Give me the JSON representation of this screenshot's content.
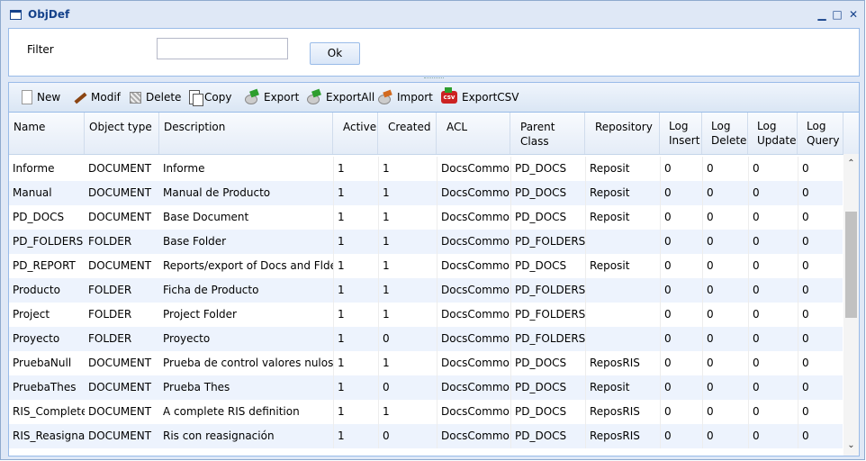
{
  "window": {
    "title": "ObjDef"
  },
  "filter": {
    "label": "Filter",
    "value": "",
    "ok_label": "Ok"
  },
  "toolbar": {
    "new_label": "New",
    "modif_label": "Modif",
    "delete_label": "Delete",
    "copy_label": "Copy",
    "export_label": "Export",
    "exportall_label": "ExportAll",
    "import_label": "Import",
    "exportcsv_label": "ExportCSV"
  },
  "columns": [
    {
      "label": "Name"
    },
    {
      "label": "Object type"
    },
    {
      "label": "Description"
    },
    {
      "label": "Active"
    },
    {
      "label": "Created"
    },
    {
      "label": "ACL"
    },
    {
      "label": "Parent Class"
    },
    {
      "label": "Repository"
    },
    {
      "label": "Log Insert"
    },
    {
      "label": "Log Delete"
    },
    {
      "label": "Log Update"
    },
    {
      "label": "Log Query"
    }
  ],
  "rows": [
    [
      "Informe",
      "DOCUMENT",
      "Informe",
      "1",
      "1",
      "DocsCommon",
      "PD_DOCS",
      "Reposit",
      "0",
      "0",
      "0",
      "0"
    ],
    [
      "Manual",
      "DOCUMENT",
      "Manual de Producto",
      "1",
      "1",
      "DocsCommon",
      "PD_DOCS",
      "Reposit",
      "0",
      "0",
      "0",
      "0"
    ],
    [
      "PD_DOCS",
      "DOCUMENT",
      "Base Document",
      "1",
      "1",
      "DocsCommon",
      "PD_DOCS",
      "Reposit",
      "0",
      "0",
      "0",
      "0"
    ],
    [
      "PD_FOLDERS",
      "FOLDER",
      "Base Folder",
      "1",
      "1",
      "DocsCommon",
      "PD_FOLDERS",
      "",
      "0",
      "0",
      "0",
      "0"
    ],
    [
      "PD_REPORT",
      "DOCUMENT",
      "Reports/export of Docs and Flders",
      "1",
      "1",
      "DocsCommon",
      "PD_DOCS",
      "Reposit",
      "0",
      "0",
      "0",
      "0"
    ],
    [
      "Producto",
      "FOLDER",
      "Ficha de Producto",
      "1",
      "1",
      "DocsCommon",
      "PD_FOLDERS",
      "",
      "0",
      "0",
      "0",
      "0"
    ],
    [
      "Project",
      "FOLDER",
      "Project Folder",
      "1",
      "1",
      "DocsCommon",
      "PD_FOLDERS",
      "",
      "0",
      "0",
      "0",
      "0"
    ],
    [
      "Proyecto",
      "FOLDER",
      "Proyecto",
      "1",
      "0",
      "DocsCommon",
      "PD_FOLDERS",
      "",
      "0",
      "0",
      "0",
      "0"
    ],
    [
      "PruebaNull",
      "DOCUMENT",
      "Prueba de control valores nulos",
      "1",
      "1",
      "DocsCommon",
      "PD_DOCS",
      "ReposRIS",
      "0",
      "0",
      "0",
      "0"
    ],
    [
      "PruebaThes",
      "DOCUMENT",
      "Prueba Thes",
      "1",
      "0",
      "DocsCommon",
      "PD_DOCS",
      "Reposit",
      "0",
      "0",
      "0",
      "0"
    ],
    [
      "RIS_Complete",
      "DOCUMENT",
      "A complete RIS definition",
      "1",
      "1",
      "DocsCommon",
      "PD_DOCS",
      "ReposRIS",
      "0",
      "0",
      "0",
      "0"
    ],
    [
      "RIS_Reasignad",
      "DOCUMENT",
      "Ris con reasignación",
      "1",
      "0",
      "DocsCommon",
      "PD_DOCS",
      "ReposRIS",
      "0",
      "0",
      "0",
      "0"
    ]
  ]
}
